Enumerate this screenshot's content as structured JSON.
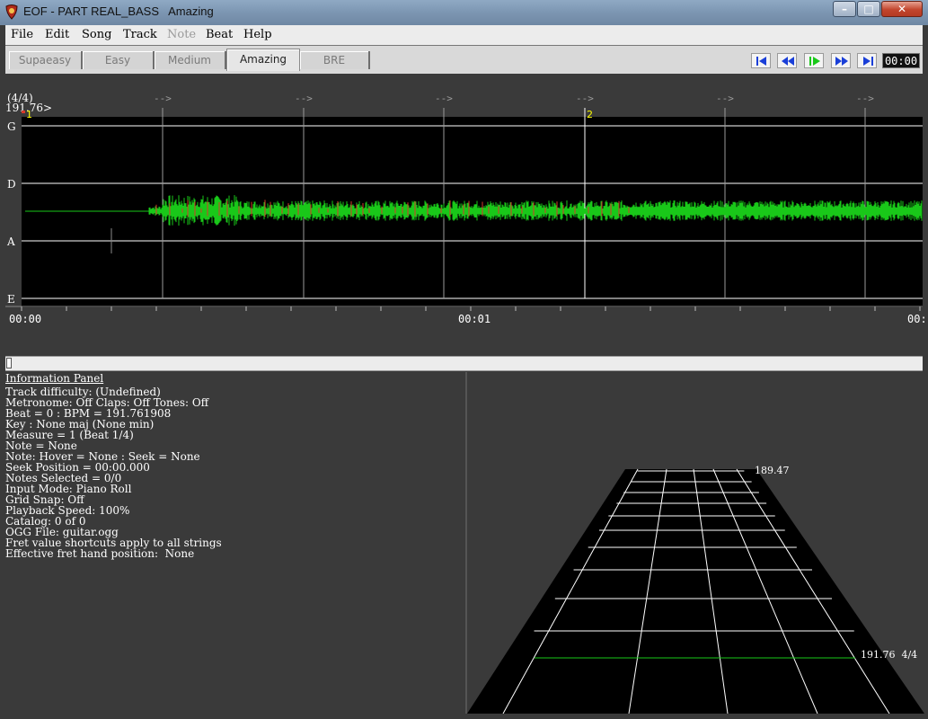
{
  "window": {
    "title": "EOF - PART REAL_BASS   Amazing",
    "controls": {
      "minimize": "–",
      "maximize": "□",
      "close": "✕"
    }
  },
  "menu": [
    "File",
    "Edit",
    "Song",
    "Track",
    "Note",
    "Beat",
    "Help"
  ],
  "menu_disabled": [
    "Note"
  ],
  "difficulty_tabs": [
    "Supaeasy",
    "Easy",
    "Medium",
    "Amazing",
    "BRE"
  ],
  "active_tab": "Amazing",
  "transport": {
    "buttons": [
      "skip-to-start",
      "rewind",
      "play",
      "fast-forward",
      "skip-to-end"
    ],
    "time": "00:00"
  },
  "editor": {
    "time_signature": "(4/4)",
    "bpm_marker": "191.76>",
    "strings": [
      "G",
      "D",
      "A",
      "E"
    ],
    "measure_markers": [
      "1",
      "2"
    ],
    "beat_arrow": "-->",
    "timecodes": [
      "00:00",
      "00:01",
      "00:"
    ],
    "colors": {
      "background": "#000000",
      "waveform": "#19c819",
      "waveform_peak": "#d83a2a",
      "measure_marker": "#ffff00"
    }
  },
  "info_panel": {
    "title": "Information Panel",
    "lines": [
      "Track difficulty: (Undefined)",
      "Metronome: Off Claps: Off Tones: Off",
      "Beat = 0 : BPM = 191.761908",
      "Key : None maj (None min)",
      "Measure = 1 (Beat 1/4)",
      "Note = None",
      "Note: Hover = None : Seek = None",
      "Seek Position = 00:00.000",
      "Notes Selected = 0/0",
      "Input Mode: Piano Roll",
      "Grid Snap: Off",
      "Playback Speed: 100%",
      "Catalog: 0 of 0",
      "OGG File: guitar.ogg",
      "Fret value shortcuts apply to all strings",
      "Effective fret hand position:  None"
    ]
  },
  "fretboard": {
    "far_label": "189.47",
    "near_label": "191.76  4/4"
  },
  "scroll": {
    "position_fraction": 0
  }
}
